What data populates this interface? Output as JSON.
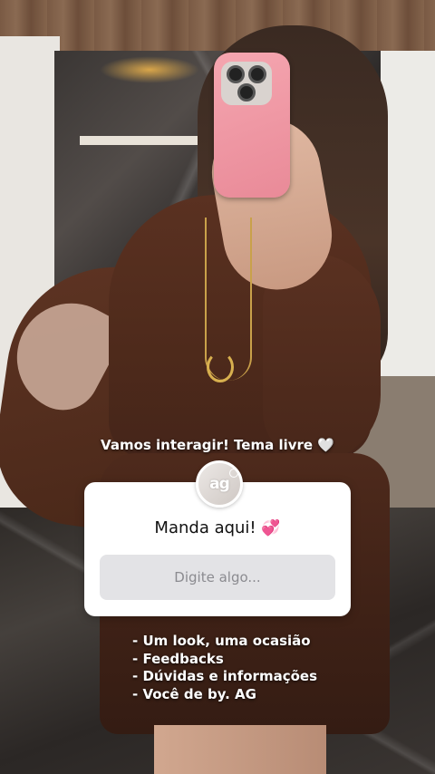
{
  "story": {
    "prompt_caption": "Vamos interagir! Tema livre 🤍",
    "question_sticker": {
      "avatar_initials": "ag",
      "title": "Manda aqui!",
      "title_emoji": "💞",
      "answer_placeholder": "Digite algo..."
    },
    "topics": [
      "- Um look, uma ocasião",
      "- Feedbacks",
      "- Dúvidas e informações",
      "- Você de by. AG"
    ]
  },
  "colors": {
    "card_background": "#ffffff",
    "answer_box": "#e3e3e6",
    "placeholder_text": "#8b8b90"
  }
}
